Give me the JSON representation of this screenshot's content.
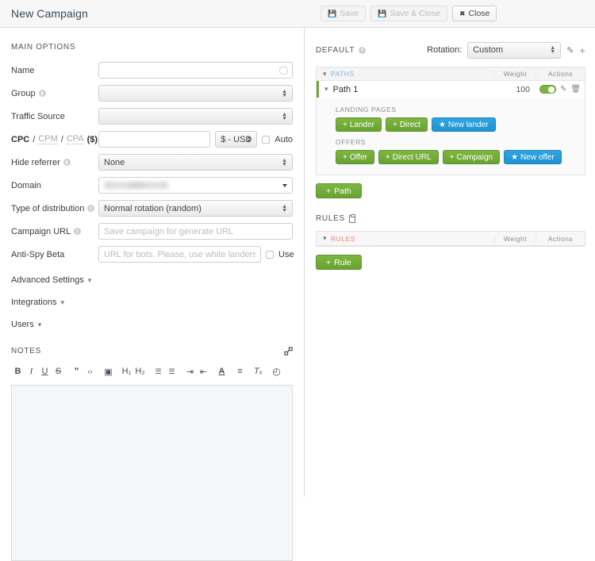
{
  "header": {
    "title": "New Campaign",
    "buttons": [
      {
        "label": "Save",
        "icon": "floppy-disk-icon",
        "disabled": true
      },
      {
        "label": "Save & Close",
        "icon": "floppy-disk-icon",
        "disabled": true
      },
      {
        "label": "Close",
        "icon": "x-icon",
        "disabled": false
      }
    ]
  },
  "main_options": {
    "section_title": "MAIN OPTIONS",
    "name": {
      "label": "Name",
      "value": "",
      "placeholder": ""
    },
    "group": {
      "label": "Group",
      "value": "",
      "has_help": true
    },
    "traffic_source": {
      "label": "Traffic Source",
      "value": "",
      "has_help": false
    },
    "cpc": {
      "label_parts": [
        "CPC",
        "/",
        "CPM",
        "/",
        "CPA",
        "($)"
      ],
      "value": "",
      "currency": "$ - USD",
      "auto_label": "Auto",
      "auto_checked": false
    },
    "hide_referrer": {
      "label": "Hide referrer",
      "value": "None",
      "has_help": true
    },
    "domain": {
      "label": "Domain",
      "value": "",
      "redacted": true
    },
    "type_of_distribution": {
      "label": "Type of distribution",
      "value": "Normal rotation (random)",
      "has_help": true
    },
    "campaign_url": {
      "label": "Campaign URL",
      "value": "",
      "placeholder": "Save campaign for generate URL",
      "has_help": true
    },
    "anti_spy": {
      "label": "Anti-Spy Beta",
      "value": "",
      "placeholder": "URL for bots. Please, use white landers, NOT google.com",
      "use_label": "Use",
      "use_checked": false
    }
  },
  "collapsibles": [
    {
      "label": "Advanced Settings",
      "icon": "chevron-down-icon"
    },
    {
      "label": "Integrations",
      "icon": "chevron-down-icon"
    },
    {
      "label": "Users",
      "icon": "chevron-down-icon"
    }
  ],
  "notes": {
    "label": "NOTES",
    "expand_icon": "expand-arrows-icon",
    "content": "",
    "toolbar": [
      {
        "name": "bold-icon",
        "glyph": "B",
        "style": "bold"
      },
      {
        "name": "italic-icon",
        "glyph": "I",
        "style": "italic"
      },
      {
        "name": "underline-icon",
        "glyph": "U",
        "style": "underline"
      },
      {
        "name": "strikethrough-icon",
        "glyph": "S",
        "style": "strike"
      },
      {
        "name": "blockquote-icon",
        "glyph": "”",
        "style": "plain"
      },
      {
        "name": "code-icon",
        "glyph": "‹›",
        "style": "small"
      },
      {
        "name": "image-icon",
        "glyph": "▣",
        "style": "plain"
      },
      {
        "name": "heading-1-icon",
        "glyph": "H₁",
        "style": "plain"
      },
      {
        "name": "heading-2-icon",
        "glyph": "H₂",
        "style": "plain"
      },
      {
        "name": "ordered-list-icon",
        "glyph": "☰",
        "style": "plain"
      },
      {
        "name": "unordered-list-icon",
        "glyph": "☰",
        "style": "plain"
      },
      {
        "name": "indent-icon",
        "glyph": "⇥",
        "style": "plain"
      },
      {
        "name": "outdent-icon",
        "glyph": "⇤",
        "style": "plain"
      },
      {
        "name": "text-color-icon",
        "glyph": "A",
        "style": "underline"
      },
      {
        "name": "align-icon",
        "glyph": "≡",
        "style": "plain"
      },
      {
        "name": "clear-format-icon",
        "glyph": "Tₓ",
        "style": "italic"
      },
      {
        "name": "history-icon",
        "glyph": "◴",
        "style": "plain"
      }
    ]
  },
  "default_panel": {
    "title": "DEFAULT",
    "has_help": true,
    "rotation_label": "Rotation:",
    "rotation_value": "Custom",
    "edit_icon": "pencil-icon",
    "add_icon": "plus-icon",
    "table": {
      "header": {
        "name": "PATHS",
        "weight": "Weight",
        "actions": "Actions",
        "collapse_icon": "chevron-down-icon"
      },
      "rows": [
        {
          "name": "Path 1",
          "weight": "100",
          "enabled": true,
          "collapse_icon": "chevron-down-icon",
          "edit_icon": "pencil-icon",
          "delete_icon": "trash-icon",
          "landing_pages": {
            "label": "LANDING PAGES",
            "buttons": [
              {
                "label": "Lander",
                "icon": "plus-icon",
                "color": "green"
              },
              {
                "label": "Direct",
                "icon": "plus-icon",
                "color": "green"
              },
              {
                "label": "New lander",
                "icon": "star-icon",
                "color": "blue"
              }
            ]
          },
          "offers": {
            "label": "OFFERS",
            "buttons": [
              {
                "label": "Offer",
                "icon": "plus-icon",
                "color": "green"
              },
              {
                "label": "Direct URL",
                "icon": "plus-icon",
                "color": "green"
              },
              {
                "label": "Campaign",
                "icon": "plus-icon",
                "color": "green"
              },
              {
                "label": "New offer",
                "icon": "star-icon",
                "color": "blue"
              }
            ]
          }
        }
      ]
    },
    "add_path_button": {
      "label": "Path",
      "icon": "plus-icon"
    }
  },
  "rules_panel": {
    "title": "RULES",
    "clipboard_icon": "clipboard-icon",
    "table": {
      "header": {
        "name": "RULES",
        "weight": "Weight",
        "actions": "Actions",
        "collapse_icon": "chevron-down-icon"
      },
      "rows": []
    },
    "add_rule_button": {
      "label": "Rule",
      "icon": "plus-icon"
    }
  },
  "colors": {
    "green": "#6fa539",
    "blue": "#1f93d0",
    "paths_header": "#7fb5dd",
    "rules_header": "#ef8275",
    "title_text": "#3a4a5a"
  }
}
